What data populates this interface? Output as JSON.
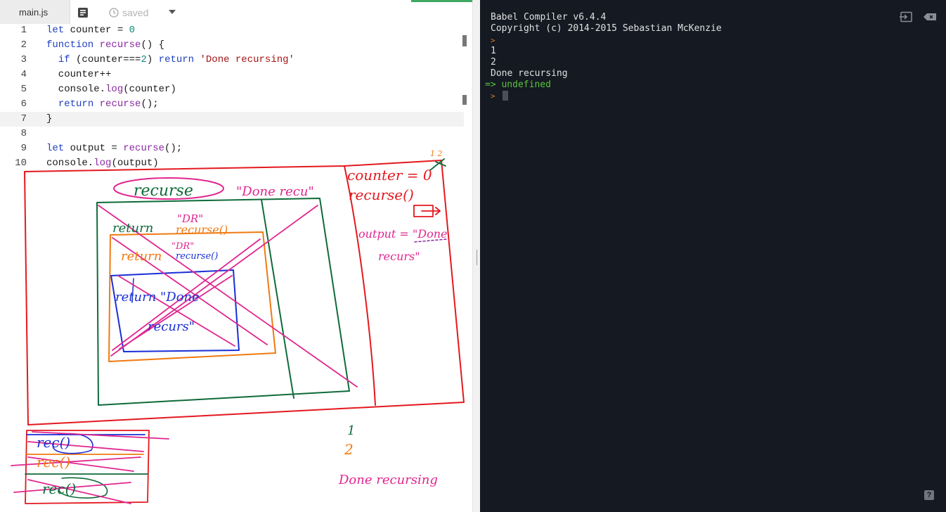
{
  "editor": {
    "tab_label": "main.js",
    "status_label": "saved",
    "icons": {
      "format": "format-icon",
      "history": "history-icon",
      "dropdown": "chevron-down-icon"
    },
    "lines": [
      {
        "number": "1",
        "text": "let counter = 0"
      },
      {
        "number": "2",
        "text": "function recurse() {"
      },
      {
        "number": "3",
        "text": "  if (counter===2) return 'Done recursing'"
      },
      {
        "number": "4",
        "text": "  counter++"
      },
      {
        "number": "5",
        "text": "  console.log(counter)"
      },
      {
        "number": "6",
        "text": "  return recurse();"
      },
      {
        "number": "7",
        "text": "}"
      },
      {
        "number": "8",
        "text": ""
      },
      {
        "number": "9",
        "text": "let output = recurse();"
      },
      {
        "number": "10",
        "text": "console.log(output)"
      }
    ],
    "active_line": "7"
  },
  "annotations": {
    "outer_label": "recurse",
    "outer_value": "\"Done recu\"",
    "frame1_return": "return",
    "frame1_value": "\"DR\"",
    "frame1_call": "recurse()",
    "frame2_return": "return",
    "frame2_value": "\"DR\"",
    "frame2_call": "recurse()",
    "frame3_return": "return \"Done",
    "frame3_value": "recurs\"",
    "memory_counter": "counter = 0",
    "memory_counter_updates": "1 2",
    "memory_recurse": "recurse()",
    "memory_output": "output = \"Done",
    "memory_output2": "recurs\"",
    "stack_top": "rec()",
    "stack_mid": "rec()",
    "stack_bottom": "rec()",
    "out_1": "1",
    "out_2": "2",
    "out_done": "Done recursing"
  },
  "console": {
    "header1": "Babel Compiler v6.4.4",
    "header2": "Copyright (c) 2014-2015 Sebastian McKenzie",
    "prompt": ">",
    "out1": "1",
    "out2": "2",
    "out3": "Done recursing",
    "result": "=> undefined",
    "icons": {
      "exit": "exit-icon",
      "clear": "clear-icon",
      "help": "help-icon"
    },
    "help_label": "?"
  },
  "colors": {
    "ink_red": "#e3191f",
    "ink_green": "#0f6b3a",
    "ink_magenta": "#e0268f",
    "ink_orange": "#f07a12",
    "ink_blue": "#1a2fd6",
    "console_bg": "#141922",
    "console_result": "#5ac43b",
    "console_prompt": "#d37d2a"
  }
}
